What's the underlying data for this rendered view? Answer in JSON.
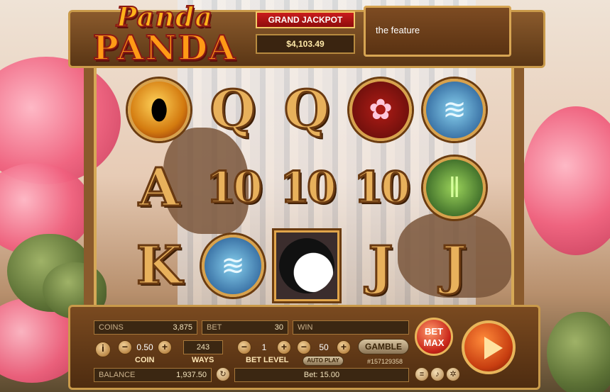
{
  "logo": {
    "line1": "Panda",
    "line2": "PANDA"
  },
  "jackpot": {
    "title": "GRAND JACKPOT",
    "value": "$4,103.49"
  },
  "feature": {
    "text": "the feature"
  },
  "reels": {
    "rows": [
      [
        {
          "kind": "round",
          "style": "gold",
          "icon": "gold-ingot-icon",
          "glyph": "⬮"
        },
        {
          "kind": "letter",
          "text": "Q"
        },
        {
          "kind": "letter",
          "text": "Q"
        },
        {
          "kind": "round",
          "style": "flower",
          "icon": "cherry-blossom-icon",
          "glyph": "✿"
        },
        {
          "kind": "round",
          "style": "water",
          "icon": "waterfall-icon",
          "glyph": "≋"
        }
      ],
      [
        {
          "kind": "letter",
          "text": "A"
        },
        {
          "kind": "letter",
          "text": "10"
        },
        {
          "kind": "letter",
          "text": "10"
        },
        {
          "kind": "letter",
          "text": "10"
        },
        {
          "kind": "round",
          "style": "bamboo",
          "icon": "bamboo-icon",
          "glyph": "‖"
        }
      ],
      [
        {
          "kind": "letter",
          "text": "K"
        },
        {
          "kind": "round",
          "style": "water",
          "icon": "waterfall-icon",
          "glyph": "≋"
        },
        {
          "kind": "panda",
          "icon": "panda-wild-icon"
        },
        {
          "kind": "letter",
          "text": "J"
        },
        {
          "kind": "letter",
          "text": "J"
        }
      ]
    ]
  },
  "panel": {
    "coins_label": "COINS",
    "coins_value": "3,875",
    "bet_label": "BET",
    "bet_value": "30",
    "win_label": "WIN",
    "win_value": "",
    "coin_value": "0.50",
    "coin_label": "COIN",
    "ways_value": "243",
    "ways_label": "WAYS",
    "bet_level_value": "1",
    "bet_level_label": "BET LEVEL",
    "auto_count": "50",
    "auto_label": "AUTO PLAY",
    "gamble_label": "GAMBLE",
    "game_id": "#157129358",
    "balance_label": "BALANCE",
    "balance_value": "1,937.50",
    "bet_total": "Bet: 15.00",
    "bet_max_label": "BET MAX",
    "info_icon": "i",
    "minus": "−",
    "plus": "+"
  }
}
